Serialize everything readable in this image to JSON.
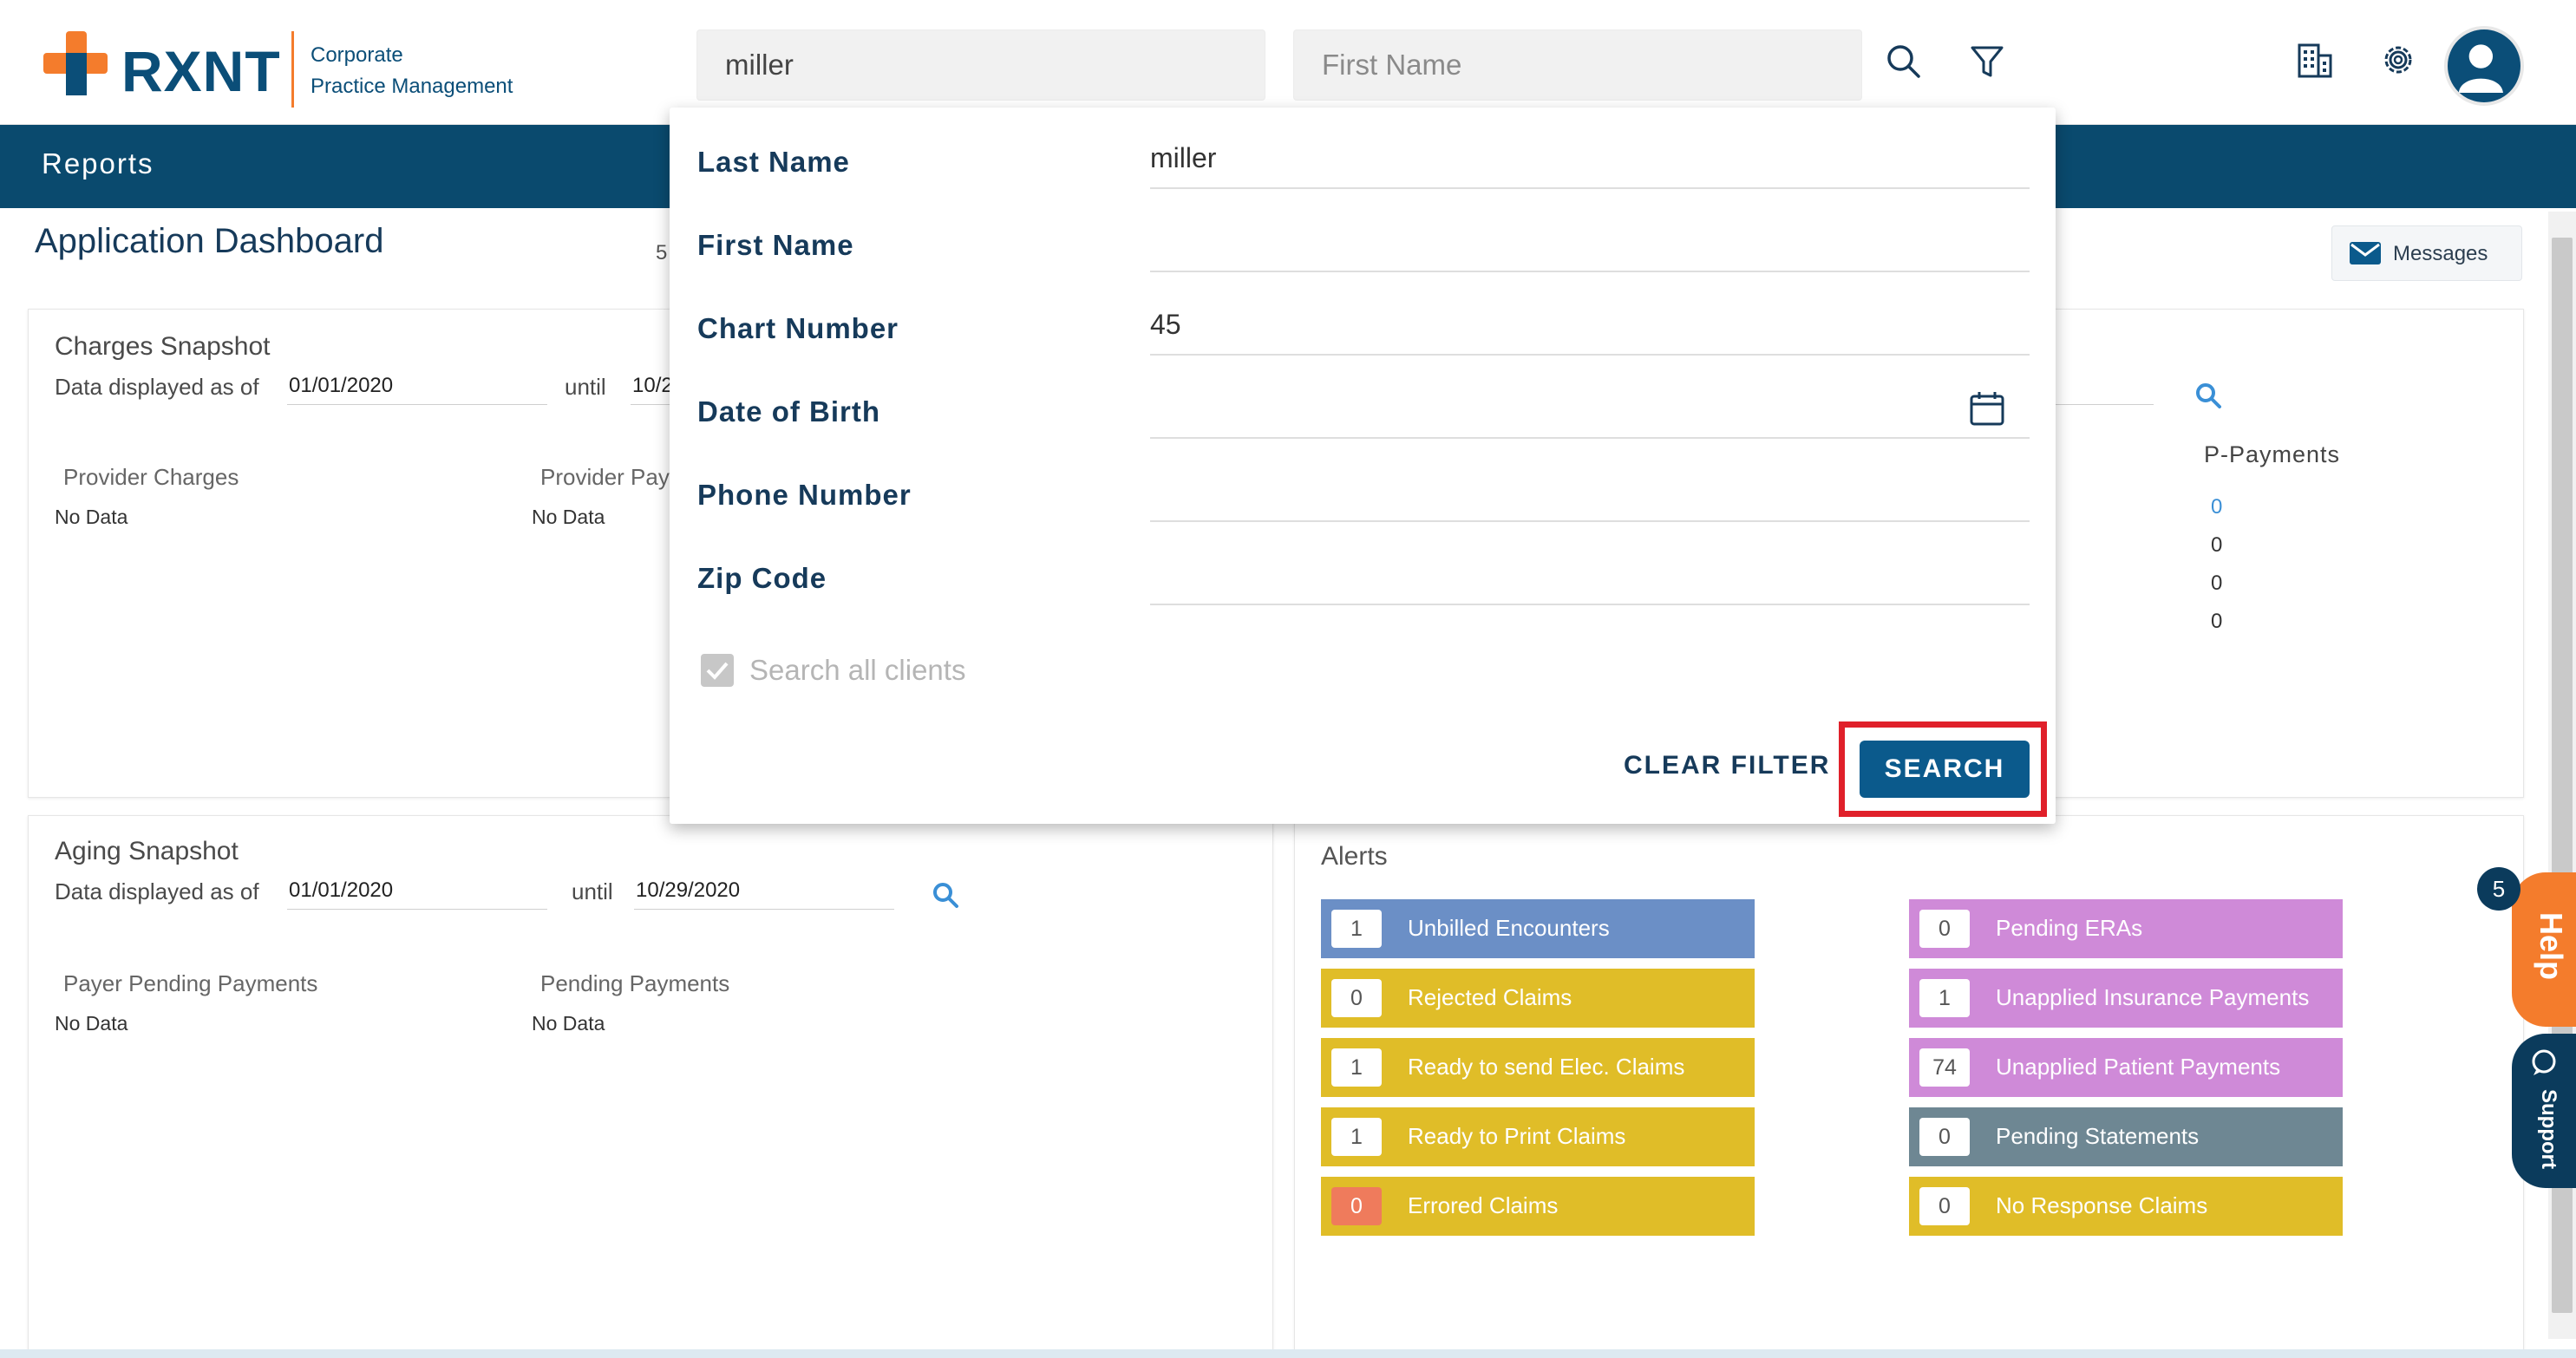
{
  "brand": {
    "name": "RXNT",
    "subtitle_line1": "Corporate",
    "subtitle_line2": "Practice Management",
    "colors": {
      "navy": "#0b4e78",
      "orange": "#f47c2c",
      "nav_bg": "#0a4a6e"
    }
  },
  "header": {
    "last_name_value": "miller",
    "first_name_placeholder": "First Name",
    "icons": [
      "search-icon",
      "filter-icon",
      "building-icon",
      "gear-icon",
      "user-avatar-icon"
    ]
  },
  "nav": {
    "reports": "Reports"
  },
  "dashboard": {
    "title": "Application Dashboard",
    "stub_text": "5",
    "messages_label": "Messages"
  },
  "charges": {
    "title": "Charges Snapshot",
    "displayed_as_of": "Data displayed as of",
    "from_date": "01/01/2020",
    "until": "until",
    "until_date_partial": "10/2",
    "col1": "Provider Charges",
    "col2": "Provider Pay",
    "no_data": "No Data"
  },
  "payments": {
    "heading": "P-Payments",
    "values": [
      "0",
      "0",
      "0",
      "0"
    ]
  },
  "aging": {
    "title": "Aging Snapshot",
    "displayed_as_of": "Data displayed as of",
    "from_date": "01/01/2020",
    "until": "until",
    "until_date": "10/29/2020",
    "col1": "Payer Pending Payments",
    "col2": "Pending Payments",
    "no_data": "No Data"
  },
  "alerts": {
    "title": "Alerts",
    "left": [
      {
        "count": "1",
        "label": "Unbilled Encounters",
        "color": "#6b8fc6"
      },
      {
        "count": "0",
        "label": "Rejected Claims",
        "color": "#e0bd28"
      },
      {
        "count": "1",
        "label": "Ready to send Elec. Claims",
        "color": "#e0bd28"
      },
      {
        "count": "1",
        "label": "Ready to Print Claims",
        "color": "#e0bd28"
      },
      {
        "count": "0",
        "label": "Errored Claims",
        "color": "#e0bd28",
        "count_bg": "#ef7b5c"
      }
    ],
    "right": [
      {
        "count": "0",
        "label": "Pending ERAs",
        "color": "#cf8ad8"
      },
      {
        "count": "1",
        "label": "Unapplied Insurance Payments",
        "color": "#cf8ad8"
      },
      {
        "count": "74",
        "label": "Unapplied Patient Payments",
        "color": "#cf8ad8"
      },
      {
        "count": "0",
        "label": "Pending Statements",
        "color": "#6e8793"
      },
      {
        "count": "0",
        "label": "No Response Claims",
        "color": "#e0bd28"
      }
    ]
  },
  "search_panel": {
    "fields": [
      {
        "label": "Last Name",
        "value": "miller"
      },
      {
        "label": "First Name",
        "value": ""
      },
      {
        "label": "Chart Number",
        "value": "45"
      },
      {
        "label": "Date of Birth",
        "value": ""
      },
      {
        "label": "Phone Number",
        "value": ""
      },
      {
        "label": "Zip Code",
        "value": ""
      }
    ],
    "search_all_clients": "Search all clients",
    "search_all_clients_checked": true,
    "clear_filter": "CLEAR FILTER",
    "search": "SEARCH"
  },
  "widgets": {
    "help_label": "Help",
    "help_badge": "5",
    "support_label": "Support"
  }
}
